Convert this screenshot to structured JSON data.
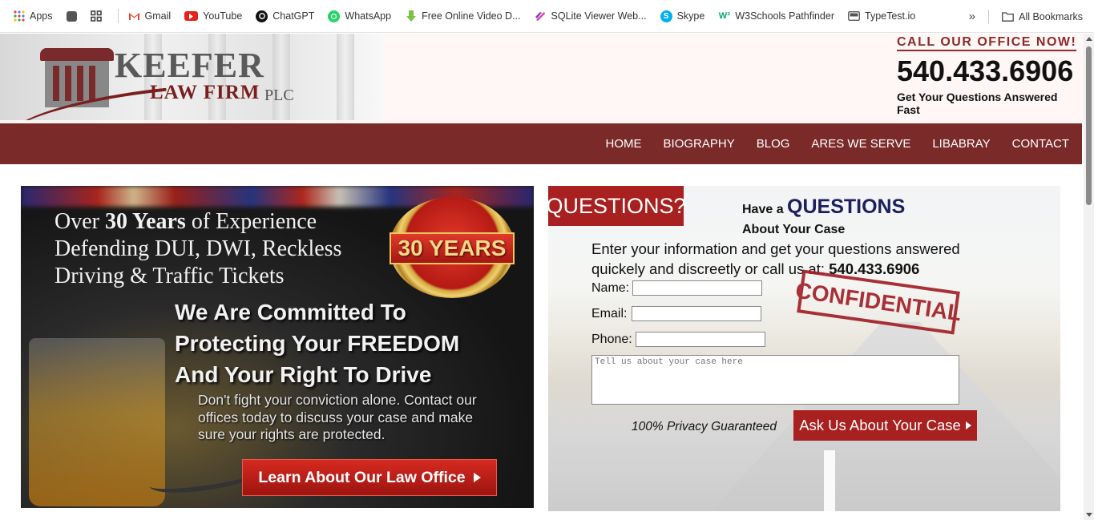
{
  "bookmarks": {
    "items": [
      {
        "label": "Apps",
        "icon": "apps-grid-icon"
      },
      {
        "label": "",
        "icon": "square-icon"
      },
      {
        "label": "",
        "icon": "grid-icon"
      },
      {
        "label": "Gmail",
        "icon": "gmail-icon"
      },
      {
        "label": "YouTube",
        "icon": "youtube-icon"
      },
      {
        "label": "ChatGPT",
        "icon": "chatgpt-icon"
      },
      {
        "label": "WhatsApp",
        "icon": "whatsapp-icon"
      },
      {
        "label": "Free Online Video D...",
        "icon": "download-icon"
      },
      {
        "label": "SQLite Viewer Web...",
        "icon": "sqlite-icon"
      },
      {
        "label": "Skype",
        "icon": "skype-icon"
      },
      {
        "label": "W3Schools Pathfinder",
        "icon": "w3schools-icon"
      },
      {
        "label": "TypeTest.io",
        "icon": "typetest-icon"
      }
    ],
    "all_bookmarks": "All Bookmarks"
  },
  "header": {
    "logo_main": "KEEFER",
    "logo_sub": "LAW FIRM",
    "logo_plc": "PLC",
    "call_now": "CALL OUR OFFICE NOW!",
    "phone": "540.433.6906",
    "tagline": "Get Your Questions Answered Fast"
  },
  "nav": {
    "items": [
      "HOME",
      "BIOGRAPHY",
      "BLOG",
      "ARES WE SERVE",
      "LIBABRAY",
      "CONTACT"
    ]
  },
  "hero": {
    "line1_pre": "Over ",
    "line1_bold": "30 Years",
    "line1_post": " of Experience",
    "line2": "Defending DUI, DWI, Reckless",
    "line3": "Driving & Traffic Tickets",
    "committed1": "We Are Committed To",
    "committed2": "Protecting Your FREEDOM",
    "committed3": "And Your Right To Drive",
    "body": "Don't fight your conviction alone.  Contact our offices today to discuss your case and make sure your rights are protected.",
    "badge": "30 YEARS",
    "button": "Learn About Our Law Office"
  },
  "form": {
    "tag": "QUESTIONS?",
    "have_a": "Have a ",
    "questions": "QUESTIONS",
    "about": "About Your Case",
    "intro": "Enter your information and get your questions answered quickely and discreetly or call us at: ",
    "intro_phone": "540.433.6906",
    "name_label": "Name:",
    "email_label": "Email:",
    "phone_label": "Phone:",
    "textarea_placeholder": "Tell us about your case here",
    "stamp": "CONFIDENTIAL",
    "privacy": "100% Privacy Guaranteed",
    "submit": "Ask Us About Your Case"
  },
  "colors": {
    "brand": "#7b2a2a",
    "button_red": "#a82020",
    "heading_navy": "#1c2060"
  }
}
